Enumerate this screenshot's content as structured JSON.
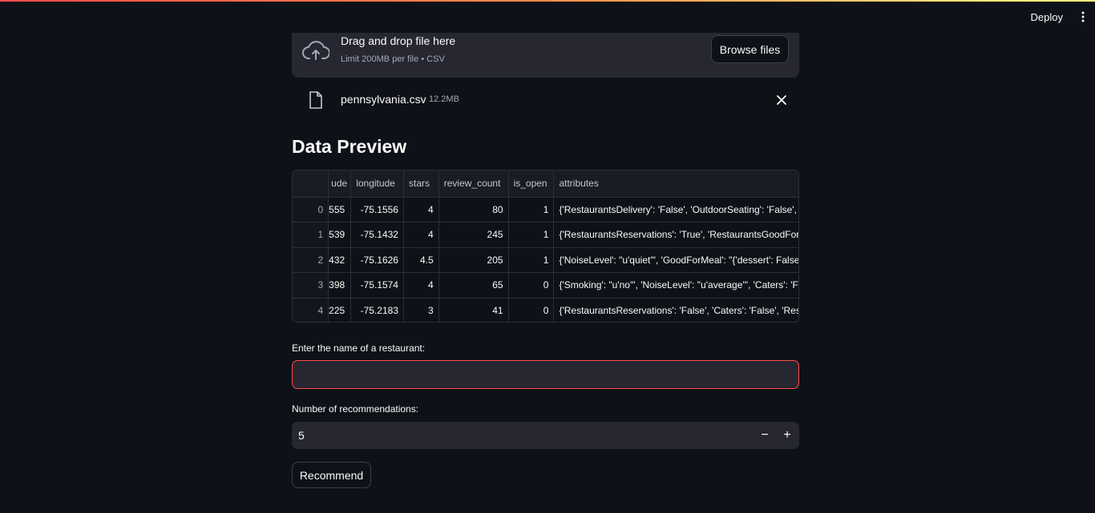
{
  "header": {
    "deploy_label": "Deploy",
    "menu_icon": "kebab-menu-icon"
  },
  "uploader": {
    "title": "Drag and drop file here",
    "subtitle": "Limit 200MB per file • CSV",
    "browse_label": "Browse files",
    "icon": "cloud-upload-icon"
  },
  "uploaded_file": {
    "name": "pennsylvania.csv",
    "size": "12.2MB",
    "icon": "file-icon"
  },
  "section_title": "Data Preview",
  "dataframe": {
    "columns": [
      "",
      "ude",
      "longitude",
      "stars",
      "review_count",
      "is_open",
      "attributes"
    ],
    "rows": [
      [
        "0",
        "555",
        "-75.1556",
        "4",
        "80",
        "1",
        "{'RestaurantsDelivery': 'False', 'OutdoorSeating': 'False', 'I"
      ],
      [
        "1",
        "539",
        "-75.1432",
        "4",
        "245",
        "1",
        "{'RestaurantsReservations': 'True', 'RestaurantsGoodForG"
      ],
      [
        "2",
        "432",
        "-75.1626",
        "4.5",
        "205",
        "1",
        "{'NoiseLevel': \"u'quiet'\", 'GoodForMeal': \"{'dessert': False"
      ],
      [
        "3",
        "398",
        "-75.1574",
        "4",
        "65",
        "0",
        "{'Smoking': \"u'no'\", 'NoiseLevel': \"u'average'\", 'Caters': 'F"
      ],
      [
        "4",
        "225",
        "-75.2183",
        "3",
        "41",
        "0",
        "{'RestaurantsReservations': 'False', 'Caters': 'False', 'Resta"
      ]
    ]
  },
  "restaurant_input": {
    "label": "Enter the name of a restaurant:",
    "value": ""
  },
  "recommendations_input": {
    "label": "Number of recommendations:",
    "value": "5",
    "decrement": "−",
    "increment": "+"
  },
  "recommend_button": "Recommend",
  "colors": {
    "background": "#0e1117",
    "widget": "#262730",
    "accent": "#ff4b4b"
  }
}
